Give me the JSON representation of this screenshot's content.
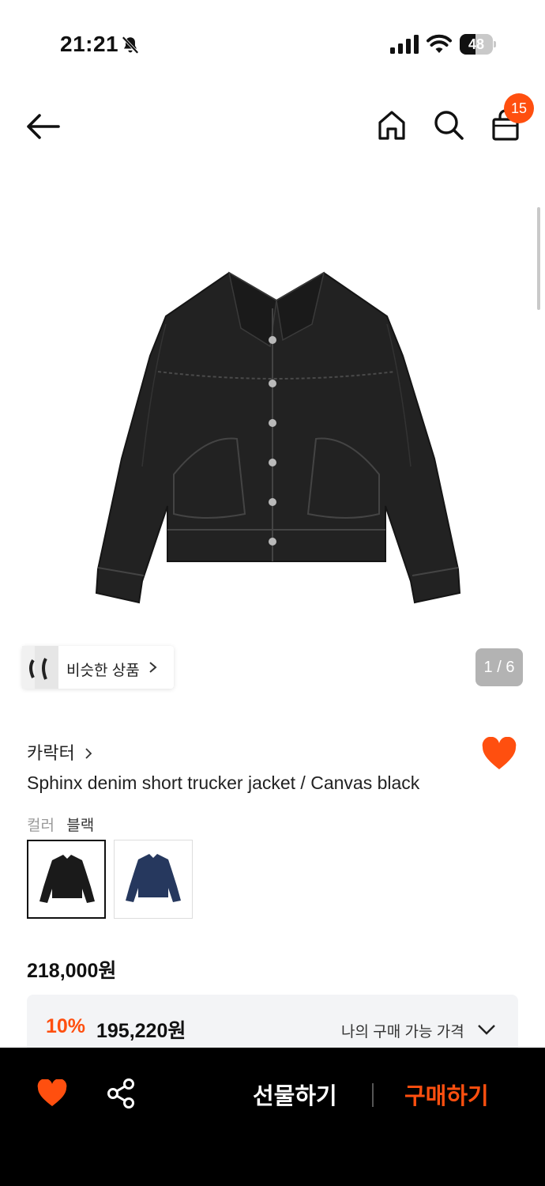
{
  "status_bar": {
    "time": "21:21",
    "battery": "48",
    "battery_level": 0.48,
    "icons": [
      "bell-off-icon",
      "signal-icon",
      "wifi-icon",
      "battery-icon"
    ]
  },
  "nav": {
    "icons": [
      "back-arrow-icon",
      "home-icon",
      "search-icon",
      "shopping-bag-icon"
    ],
    "cart_count": "15"
  },
  "gallery": {
    "similar_label": "비슷한 상품",
    "page_indicator": "1 / 6"
  },
  "product": {
    "brand": "카락터",
    "title": "Sphinx denim short trucker jacket / Canvas black",
    "liked": true,
    "color_label": "컬러",
    "color_value": "블랙",
    "swatches": [
      {
        "name": "black",
        "selected": true,
        "color": "#1a1a1a"
      },
      {
        "name": "navy",
        "selected": false,
        "color": "#26385e"
      }
    ],
    "price": "218,000원",
    "discount_rate": "10%",
    "discount_price": "195,220원",
    "my_price_label": "나의 구매 가능 가격"
  },
  "bottom_bar": {
    "gift_label": "선물하기",
    "buy_label": "구매하기"
  },
  "colors": {
    "accent": "#ff4f0f",
    "bottom_bar_bg": "#000000",
    "discount_box_bg": "#f3f4f6"
  }
}
